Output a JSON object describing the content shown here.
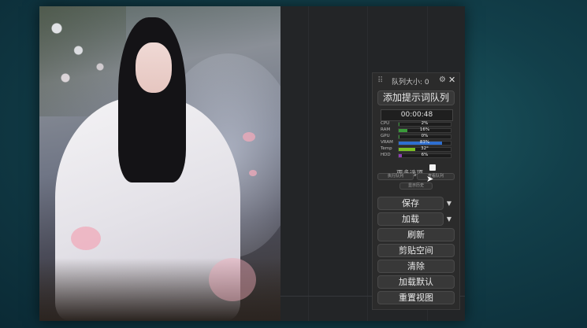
{
  "panel": {
    "queue_label": "队列大小: 0",
    "add_prompt": "添加提示词队列",
    "timer": "00:00:48",
    "monitor": [
      {
        "label": "CPU",
        "value": "2%",
        "percent": 2,
        "color": "#3a9a3a"
      },
      {
        "label": "RAM",
        "value": "16%",
        "percent": 16,
        "color": "#3a9a3a"
      },
      {
        "label": "GPU",
        "value": "0%",
        "percent": 0,
        "color": "#3a9a3a"
      },
      {
        "label": "VRAM",
        "value": "83%",
        "percent": 83,
        "color": "#2e6fd1"
      },
      {
        "label": "Temp",
        "value": "32°",
        "percent": 32,
        "color": "#7bbf24"
      },
      {
        "label": "HDD",
        "value": "6%",
        "percent": 6,
        "color": "#8e3fb3"
      }
    ],
    "more_options": "更多选项",
    "mini_left": "执行队列",
    "mini_right": "查看队列",
    "mini_history": "显示历史",
    "buttons": {
      "save": "保存",
      "load": "加载",
      "refresh": "刷新",
      "clipspace": "剪贴空间",
      "clear": "清除",
      "load_default": "加载默认",
      "reset_view": "重置视图"
    }
  }
}
